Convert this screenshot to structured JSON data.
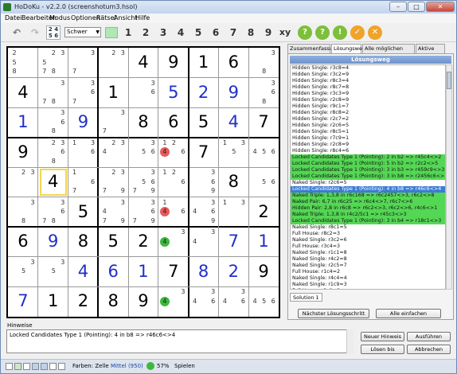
{
  "window": {
    "title": "HoDoKu - v2.2.0  (screenshotum3.hsol)",
    "buttons": [
      "–",
      "□",
      "✕"
    ]
  },
  "menu": [
    "Datei",
    "Bearbeiten",
    "Modus",
    "Optionen",
    "Rätsel",
    "Ansicht",
    "Hilfe"
  ],
  "toolbar": {
    "undo_icon": "undo-arrow-icon",
    "redo_icon": "redo-arrow-icon",
    "level": "Schwer",
    "digits": [
      "1",
      "2",
      "3",
      "4",
      "5",
      "6",
      "7",
      "8",
      "9"
    ],
    "xy_label": "xy",
    "circle_buttons": [
      {
        "label": "?",
        "color": "#7dbf3a"
      },
      {
        "label": "?",
        "color": "#7dbf3a"
      },
      {
        "label": "!",
        "color": "#7dbf3a"
      },
      {
        "label": "✓",
        "color": "#f0a32a"
      },
      {
        "label": "✕",
        "color": "#f0a32a"
      }
    ]
  },
  "grid": {
    "given_color": "#000000",
    "user_color": "#1e2fc8",
    "cells": [
      [
        {
          "c": [
            "2",
            "",
            "",
            "5",
            "",
            "",
            "8",
            "",
            ""
          ]
        },
        {
          "c": [
            "",
            "2",
            "3",
            "5",
            "",
            "",
            "7",
            "8",
            ""
          ]
        },
        {
          "c": [
            "",
            "",
            "3",
            "",
            "",
            "",
            "7",
            "",
            ""
          ]
        },
        {
          "c": [
            "",
            "2",
            "3",
            "",
            "",
            "",
            "",
            "",
            ""
          ]
        },
        {
          "v": "4",
          "g": true
        },
        {
          "v": "9",
          "g": true
        },
        {
          "v": "1",
          "g": true
        },
        {
          "v": "6",
          "g": true
        },
        {
          "c": [
            "",
            "",
            "3",
            "",
            "",
            "",
            "",
            "8",
            ""
          ]
        }
      ],
      [
        {
          "v": "4",
          "g": true
        },
        {
          "c": [
            "",
            "",
            "3",
            "",
            "",
            "",
            "7",
            "8",
            ""
          ]
        },
        {
          "c": [
            "",
            "",
            "3",
            "",
            "",
            "6",
            "7",
            "",
            ""
          ]
        },
        {
          "v": "1",
          "g": true
        },
        {
          "c": [
            "",
            "",
            "3",
            "",
            "",
            "6",
            "",
            "",
            ""
          ]
        },
        {
          "v": "5",
          "g": false
        },
        {
          "v": "2",
          "g": false
        },
        {
          "v": "9",
          "g": false
        },
        {
          "c": [
            "",
            "",
            "3",
            "",
            "",
            "6",
            "",
            "8",
            ""
          ]
        }
      ],
      [
        {
          "v": "1",
          "g": false
        },
        {
          "c": [
            "",
            "",
            "3",
            "",
            "",
            "6",
            "",
            "8",
            ""
          ]
        },
        {
          "v": "9",
          "g": false
        },
        {
          "c": [
            "",
            "",
            "3",
            "",
            "",
            "",
            "7",
            "",
            ""
          ]
        },
        {
          "v": "8",
          "g": true
        },
        {
          "v": "6",
          "g": true
        },
        {
          "v": "5",
          "g": true
        },
        {
          "v": "4",
          "g": false
        },
        {
          "v": "7",
          "g": true
        }
      ],
      [
        {
          "v": "9",
          "g": true
        },
        {
          "c": [
            "",
            "2",
            "3",
            "",
            "",
            "6",
            "",
            "8",
            ""
          ]
        },
        {
          "c": [
            "1",
            "",
            "3",
            "",
            "",
            "6",
            "",
            "",
            ""
          ]
        },
        {
          "c": [
            "",
            "2",
            "3",
            "4",
            "",
            "",
            "",
            "",
            ""
          ]
        },
        {
          "c": [
            "",
            "",
            "3",
            "",
            "5",
            "6",
            "",
            "",
            ""
          ]
        },
        {
          "c": [
            "1",
            "2",
            "",
            "",
            "",
            "6",
            "",
            "",
            ""
          ],
          "red": "4"
        },
        {
          "v": "7",
          "g": true
        },
        {
          "c": [
            "1",
            "",
            "3",
            "",
            "5",
            "",
            "",
            "",
            ""
          ]
        },
        {
          "c": [
            "",
            "",
            "",
            "4",
            "5",
            "6",
            "",
            "",
            ""
          ]
        }
      ],
      [
        {
          "c": [
            "",
            "2",
            "3",
            "",
            "",
            "",
            "",
            "",
            ""
          ]
        },
        {
          "v": "4",
          "g": true,
          "sel": true
        },
        {
          "c": [
            "1",
            "",
            "",
            "",
            "",
            "6",
            "7",
            "",
            ""
          ]
        },
        {
          "c": [
            "",
            "2",
            "3",
            "",
            "",
            "",
            "7",
            "",
            "9"
          ]
        },
        {
          "c": [
            "",
            "",
            "3",
            "",
            "5",
            "6",
            "7",
            "",
            "9"
          ]
        },
        {
          "c": [
            "1",
            "2",
            "",
            "",
            "",
            "6",
            "",
            "",
            ""
          ]
        },
        {
          "c": [
            "",
            "",
            "3",
            "",
            "",
            "6",
            "",
            "",
            "9"
          ]
        },
        {
          "v": "8",
          "g": true
        },
        {
          "c": [
            "",
            "",
            "",
            "",
            "5",
            "6",
            "",
            "",
            ""
          ]
        }
      ],
      [
        {
          "c": [
            "",
            "",
            "3",
            "",
            "",
            "",
            "",
            "8",
            ""
          ]
        },
        {
          "c": [
            "",
            "",
            "3",
            "",
            "",
            "6",
            "7",
            "8",
            ""
          ]
        },
        {
          "v": "5",
          "g": true
        },
        {
          "c": [
            "",
            "",
            "3",
            "4",
            "",
            "",
            "7",
            "",
            "9"
          ]
        },
        {
          "c": [
            "",
            "",
            "3",
            "",
            "",
            "6",
            "7",
            "",
            "9"
          ]
        },
        {
          "c": [
            "1",
            "",
            "",
            "",
            "",
            "6",
            "",
            "",
            ""
          ],
          "red": "4"
        },
        {
          "c": [
            "",
            "",
            "3",
            "4",
            "",
            "6",
            "",
            "",
            "9"
          ]
        },
        {
          "c": [
            "1",
            "",
            "3",
            "",
            "",
            "",
            "",
            "",
            ""
          ]
        },
        {
          "v": "2",
          "g": true
        }
      ],
      [
        {
          "v": "6",
          "g": true
        },
        {
          "v": "9",
          "g": false
        },
        {
          "v": "8",
          "g": true
        },
        {
          "v": "5",
          "g": true
        },
        {
          "v": "2",
          "g": true
        },
        {
          "c": [
            "",
            "",
            "3",
            "",
            "",
            "",
            "",
            "",
            ""
          ],
          "green": "4"
        },
        {
          "c": [
            "",
            "",
            "3",
            "4",
            "",
            "",
            "",
            "",
            ""
          ]
        },
        {
          "v": "7",
          "g": false
        },
        {
          "v": "1",
          "g": false
        }
      ],
      [
        {
          "c": [
            "",
            "",
            "3",
            "",
            "5",
            "",
            "",
            "",
            ""
          ]
        },
        {
          "c": [
            "",
            "",
            "3",
            "",
            "5",
            "",
            "",
            "",
            ""
          ]
        },
        {
          "v": "4",
          "g": false
        },
        {
          "v": "6",
          "g": false
        },
        {
          "v": "1",
          "g": false
        },
        {
          "v": "7",
          "g": true
        },
        {
          "v": "8",
          "g": false
        },
        {
          "v": "2",
          "g": false
        },
        {
          "v": "9",
          "g": true
        }
      ],
      [
        {
          "v": "7",
          "g": false
        },
        {
          "v": "1",
          "g": true
        },
        {
          "v": "2",
          "g": true
        },
        {
          "v": "8",
          "g": true
        },
        {
          "v": "9",
          "g": true
        },
        {
          "c": [
            "",
            "",
            "3",
            "",
            "",
            "",
            "",
            "",
            ""
          ],
          "green": "4"
        },
        {
          "c": [
            "",
            "",
            "3",
            "4",
            "",
            "6",
            "",
            "",
            ""
          ]
        },
        {
          "c": [
            "",
            "",
            "3",
            "4",
            "",
            "6",
            "",
            "",
            ""
          ]
        },
        {
          "c": [
            "",
            "",
            "",
            "4",
            "5",
            "6",
            "",
            "",
            ""
          ]
        }
      ]
    ]
  },
  "tabs": [
    "Zusammenfassung",
    "Lösungsweg",
    "Alle möglichen Schritte",
    "Aktive Zelle"
  ],
  "panel": {
    "header": "Lösungsweg",
    "steps": [
      {
        "t": "Hidden Single: r3c8=4",
        "s": ""
      },
      {
        "t": "Hidden Single: r3c2=9",
        "s": ""
      },
      {
        "t": "Hidden Single: r8c3=4",
        "s": ""
      },
      {
        "t": "Hidden Single: r8c7=8",
        "s": ""
      },
      {
        "t": "Hidden Single: r3c3=9",
        "s": ""
      },
      {
        "t": "Hidden Single: r2c8=9",
        "s": ""
      },
      {
        "t": "Hidden Single: r9c1=7",
        "s": ""
      },
      {
        "t": "Hidden Single: r8c8=2",
        "s": ""
      },
      {
        "t": "Hidden Single: r2c7=2",
        "s": ""
      },
      {
        "t": "Hidden Single: r2c6=5",
        "s": ""
      },
      {
        "t": "Hidden Single: r8c5=1",
        "s": ""
      },
      {
        "t": "Hidden Single: r7c9=1",
        "s": ""
      },
      {
        "t": "Hidden Single: r2c8=9",
        "s": ""
      },
      {
        "t": "Hidden Single: r8c4=6",
        "s": ""
      },
      {
        "t": "Locked Candidates Type 1 (Pointing): 2 in b2 => r45c4<>2",
        "s": "green"
      },
      {
        "t": "Locked Candidates Type 1 (Pointing): 5 in b2 => r2c2<>5",
        "s": "green"
      },
      {
        "t": "Locked Candidates Type 1 (Pointing): 3 in b3 => r459c9<>3",
        "s": "green"
      },
      {
        "t": "Locked Candidates Type 1 (Pointing): 3 in b8 => r2456c6<>3",
        "s": "green"
      },
      {
        "t": "Naked Single: r2c6=5",
        "s": ""
      },
      {
        "t": "Locked Candidates Type 1 (Pointing): 4 in b8 => r46c6<>4",
        "s": "selected"
      },
      {
        "t": "Naked Triple: 1,3,8 in r6c168 => r6c2457<>3, r6c2<>8",
        "s": "green"
      },
      {
        "t": "Naked Pair: 6,7 in r6c25 => r6c4<>7, r6c7<>6",
        "s": "green"
      },
      {
        "t": "Hidden Pair: 2,8 in r6c8 => r6c2<>3, r6c2<>6, r4c6<>1",
        "s": "green"
      },
      {
        "t": "Naked Triple: 1,3,8 in r4c2/5c1 => r45c3<>3",
        "s": "green"
      },
      {
        "t": "Locked Candidates Type 1 (Pointing): 3 in b4 => r18c1<>3",
        "s": "green"
      },
      {
        "t": "Naked Single: r8c1=5",
        "s": ""
      },
      {
        "t": "Full House: r8c2=3",
        "s": ""
      },
      {
        "t": "Naked Single: r3c2=6",
        "s": ""
      },
      {
        "t": "Full House: r3c4=3",
        "s": ""
      },
      {
        "t": "Naked Single: r1c1=8",
        "s": ""
      },
      {
        "t": "Naked Single: r4c2=8",
        "s": ""
      },
      {
        "t": "Naked Single: r2c5=7",
        "s": ""
      },
      {
        "t": "Full House: r1c4=2",
        "s": ""
      },
      {
        "t": "Naked Single: r4c4=4",
        "s": ""
      },
      {
        "t": "Naked Single: r1c9=3",
        "s": ""
      },
      {
        "t": "Full House: r2c9=8",
        "s": ""
      },
      {
        "t": "Naked Single: r8c1=5",
        "s": ""
      }
    ],
    "solution_tab": "Solution 1",
    "next_step_button": "Nächster Lösungsschritt",
    "paste_all_button": "Alle einfachen"
  },
  "hint": {
    "label": "Hinweise",
    "text": "Locked Candidates Type 1 (Pointing): 4 in b8 => r46c6<>4",
    "buttons": {
      "new_hint": "Neuer Hinweis",
      "execute": "Ausführen",
      "solve_to": "Lösen bis",
      "cancel": "Abbrechen"
    }
  },
  "status": {
    "colors_label": "Farben: Zelle",
    "level": "Mittel (950)",
    "progress_percent": "57%",
    "mode": "Spielen"
  }
}
